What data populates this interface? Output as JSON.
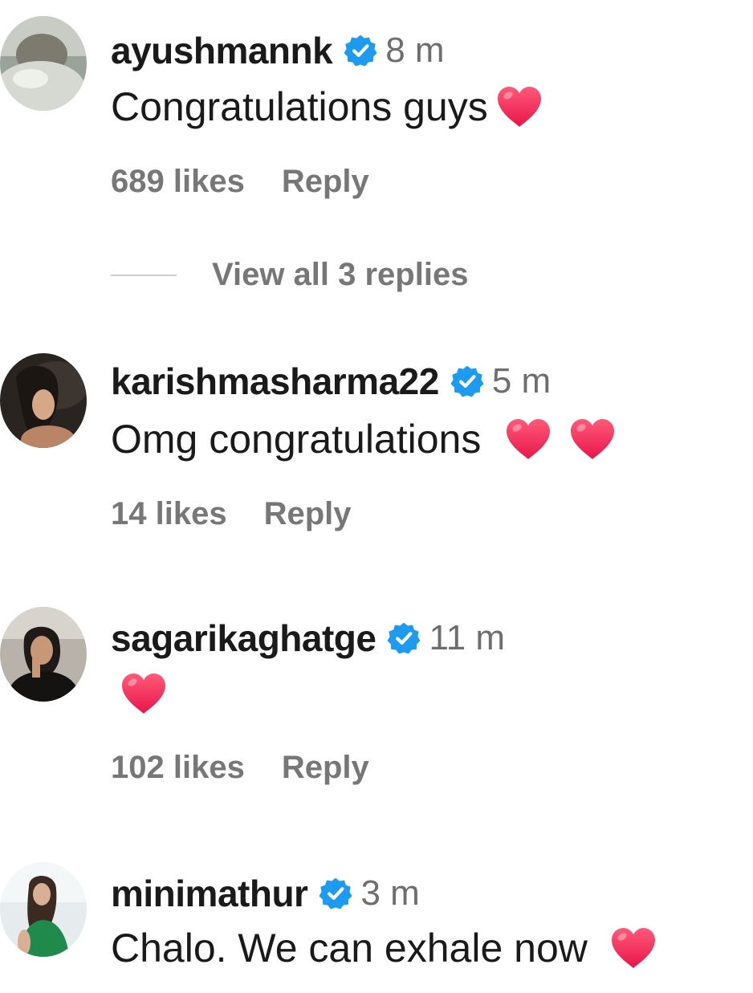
{
  "colors": {
    "username": "#1a1a1a",
    "muted": "#777777",
    "verified_blue": "#1d9bf0",
    "heart_red": "#ef2b55"
  },
  "comments": [
    {
      "username": "ayushmannk",
      "verified": true,
      "time": "8 m",
      "text": "Congratulations guys",
      "hearts": 1,
      "likes": "689 likes",
      "reply_label": "Reply",
      "view_replies": "View all 3 replies"
    },
    {
      "username": "karishmasharma22",
      "verified": true,
      "time": "5 m",
      "text": "Omg congratulations",
      "hearts": 2,
      "likes": "14 likes",
      "reply_label": "Reply"
    },
    {
      "username": "sagarikaghatge",
      "verified": true,
      "time": "11 m",
      "text": "",
      "hearts": 1,
      "likes": "102 likes",
      "reply_label": "Reply"
    },
    {
      "username": "minimathur",
      "verified": true,
      "time": "3 m",
      "text": "Chalo. We can exhale now",
      "hearts": 1
    }
  ],
  "icons": {
    "verified": "verified-badge-icon",
    "heart": "red-heart-emoji-icon"
  }
}
